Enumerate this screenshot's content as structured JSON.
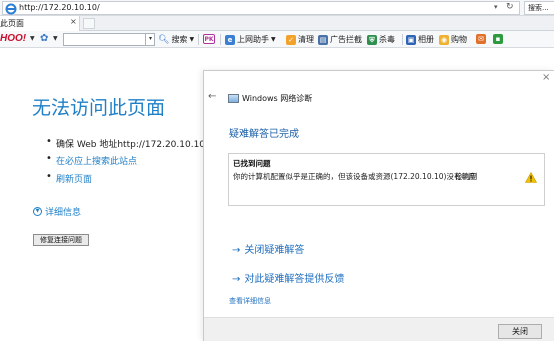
{
  "browser": {
    "url": "http://172.20.10.10/",
    "search_placeholder": "搜索...",
    "tab_title": "此页面",
    "tab_close_glyph": "×"
  },
  "toolbar": {
    "yahoo_logo": "HOO!",
    "search_button": "搜索",
    "items": {
      "pk": "PK",
      "online_assistant": "上网助手",
      "clean": "清理",
      "ad_block": "广告拦截",
      "kill_virus": "杀毒",
      "album": "相册",
      "shopping": "购物"
    }
  },
  "error_page": {
    "title": "无法访问此页面",
    "bullets": [
      {
        "text": "确保 Web 地址http://172.20.10.10",
        "link": false
      },
      {
        "text": "在必应上搜索此站点",
        "link": true
      },
      {
        "text": "刷新页面",
        "link": true
      }
    ],
    "more_info": "详细信息",
    "fix_button": "修复连接问题"
  },
  "dialog": {
    "app_title": "Windows 网络诊断",
    "heading": "疑难解答已完成",
    "problem_section_title": "已找到问题",
    "problem_text": "你的计算机配置似乎是正确的，但该设备或资源(172.20.10.10)没有响应",
    "problem_status": "检测到",
    "link_close": "关闭疑难解答",
    "link_feedback": "对此疑难解答提供反馈",
    "detail_link": "查看详细信息",
    "close_button": "关闭",
    "close_glyph": "×",
    "back_glyph": "←"
  },
  "colors": {
    "error_title": "#1f7fc7",
    "dialog_heading": "#1b5fa8",
    "link": "#1f6fbf",
    "warning": "#f2c200"
  },
  "icons": [
    "ie-logo-icon",
    "refresh-icon",
    "settings-flower-icon",
    "search-icon",
    "warning-icon",
    "back-arrow-icon",
    "close-icon",
    "info-chevron-icon"
  ]
}
